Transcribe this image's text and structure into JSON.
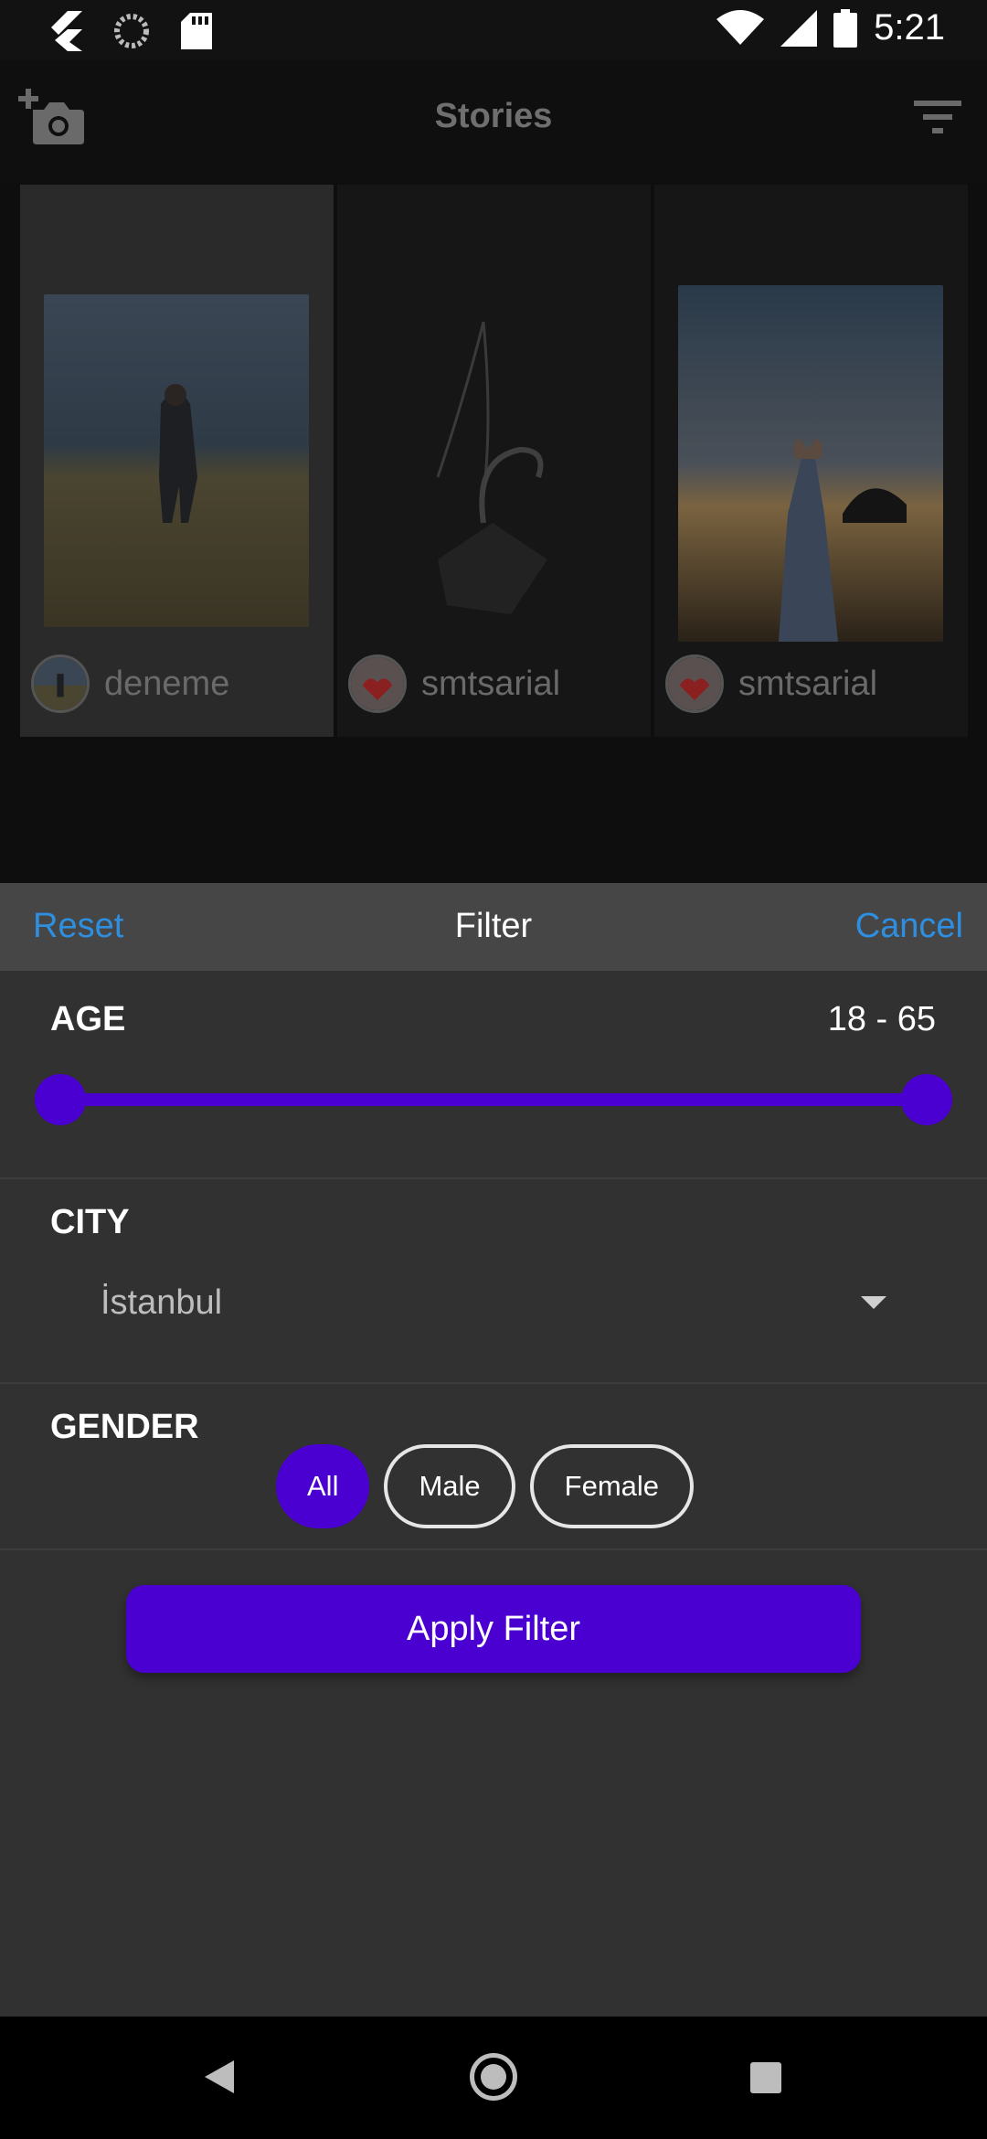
{
  "status_bar": {
    "time": "5:21",
    "icons": [
      "flutter-icon",
      "sync-icon",
      "sd-card-icon",
      "wifi-icon",
      "cell-signal-icon",
      "battery-icon"
    ]
  },
  "app_bar": {
    "title": "Stories",
    "left_icon": "add-photo-icon",
    "right_icon": "filter-list-icon"
  },
  "stories": [
    {
      "username": "deneme"
    },
    {
      "username": "smtsarial"
    },
    {
      "username": "smtsarial"
    }
  ],
  "filter_sheet": {
    "reset_label": "Reset",
    "title": "Filter",
    "cancel_label": "Cancel",
    "age": {
      "label": "AGE",
      "range_text": "18 - 65",
      "min": 18,
      "max": 65
    },
    "city": {
      "label": "CITY",
      "selected": "İstanbul"
    },
    "gender": {
      "label": "GENDER",
      "options": [
        "All",
        "Male",
        "Female"
      ],
      "selected": "All"
    },
    "apply_label": "Apply Filter"
  },
  "colors": {
    "accent": "#4a00d0",
    "link": "#2e8fe0",
    "sheet_bg": "#313131",
    "sheet_header_bg": "#464646"
  }
}
